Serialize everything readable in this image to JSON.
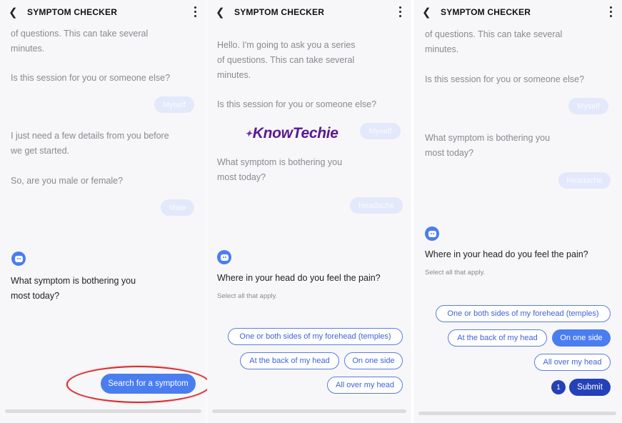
{
  "app": {
    "title": "SYMPTOM CHECKER"
  },
  "icons": {
    "back": "chevron-left-icon",
    "menu": "more-vert-icon",
    "bot": "bot-avatar-icon"
  },
  "colors": {
    "accent": "#4a7df0",
    "submit": "#2441b8",
    "user_bubble": "#e3e8fa",
    "annotation": "#d62b2b",
    "logo": "#5a1890"
  },
  "watermark": {
    "text": "KnowTechie"
  },
  "panel1": {
    "msg_intro_tail": "of questions. This can take several\nminutes.",
    "msg_session": "Is this session for you or someone else?",
    "reply_session": "Myself",
    "msg_details": "I just need a few details from you before\nwe get started.",
    "msg_gender": "So, are you male or female?",
    "reply_gender": "Male",
    "msg_symptom": "What symptom is bothering you\nmost today?",
    "search_button": "Search for a symptom"
  },
  "panel2": {
    "msg_intro": "Hello. I'm going to ask you a series\nof questions. This can take several\nminutes.",
    "msg_session": "Is this session for you or someone else?",
    "reply_session": "Myself",
    "msg_symptom": "What symptom is bothering you\nmost today?",
    "reply_symptom": "Headache",
    "question": "Where in your head do you feel the pain?",
    "hint": "Select all that apply.",
    "options": [
      "One or both sides of my forehead (temples)",
      "At the back of my head",
      "On one side",
      "All over my head"
    ]
  },
  "panel3": {
    "msg_intro_tail": "of questions. This can take several\nminutes.",
    "msg_session": "Is this session for you or someone else?",
    "reply_session": "Myself",
    "msg_symptom": "What symptom is bothering you\nmost today?",
    "reply_symptom": "Headache",
    "question": "Where in your head do you feel the pain?",
    "hint": "Select all that apply.",
    "options": [
      "One or both sides of my forehead (temples)",
      "At the back of my head",
      "On one side",
      "All over my head"
    ],
    "selected_option": "On one side",
    "selected_count": "1",
    "submit_button": "Submit"
  }
}
